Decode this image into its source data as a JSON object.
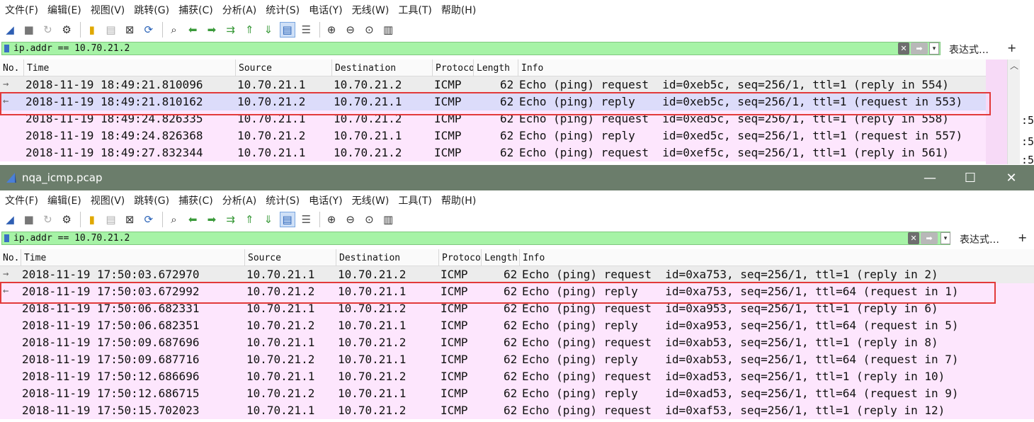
{
  "menu": [
    "文件(F)",
    "编辑(E)",
    "视图(V)",
    "跳转(G)",
    "捕获(C)",
    "分析(A)",
    "统计(S)",
    "电话(Y)",
    "无线(W)",
    "工具(T)",
    "帮助(H)"
  ],
  "toolbar_icons": [
    "shark-fin-icon",
    "stop-icon",
    "restart-icon",
    "options-gear-icon",
    "open-file-icon",
    "save-file-icon",
    "close-file-icon",
    "reload-icon",
    "find-icon",
    "go-back-icon",
    "go-forward-icon",
    "go-to-packet-icon",
    "first-packet-icon",
    "last-packet-icon",
    "autoscroll-icon",
    "colorize-icon",
    "zoom-in-icon",
    "zoom-out-icon",
    "zoom-normal-icon",
    "resize-columns-icon"
  ],
  "filter": {
    "value": "ip.addr == 10.70.21.2",
    "expression_label": "表达式…",
    "plus": "+"
  },
  "columns": {
    "no": "No.",
    "time": "Time",
    "source": "Source",
    "destination": "Destination",
    "protocol": "Protocol",
    "length": "Length",
    "info": "Info"
  },
  "top_pane": {
    "rows": [
      {
        "time": "2018-11-19 18:49:21.810096",
        "src": "10.70.21.1",
        "dst": "10.70.21.2",
        "proto": "ICMP",
        "len": "62",
        "info": "Echo (ping) request  id=0xeb5c, seq=256/1, ttl=1 (reply in 554)"
      },
      {
        "time": "2018-11-19 18:49:21.810162",
        "src": "10.70.21.2",
        "dst": "10.70.21.1",
        "proto": "ICMP",
        "len": "62",
        "info": "Echo (ping) reply    id=0xeb5c, seq=256/1, ttl=1 (request in 553)"
      },
      {
        "time": "2018-11-19 18:49:24.826335",
        "src": "10.70.21.1",
        "dst": "10.70.21.2",
        "proto": "ICMP",
        "len": "62",
        "info": "Echo (ping) request  id=0xed5c, seq=256/1, ttl=1 (reply in 558)"
      },
      {
        "time": "2018-11-19 18:49:24.826368",
        "src": "10.70.21.2",
        "dst": "10.70.21.1",
        "proto": "ICMP",
        "len": "62",
        "info": "Echo (ping) reply    id=0xed5c, seq=256/1, ttl=1 (request in 557)"
      },
      {
        "time": "2018-11-19 18:49:27.832344",
        "src": "10.70.21.1",
        "dst": "10.70.21.2",
        "proto": "ICMP",
        "len": "62",
        "info": "Echo (ping) request  id=0xef5c, seq=256/1, ttl=1 (reply in 561)"
      }
    ],
    "side_fragments": [
      ":5",
      ":5",
      ":5"
    ]
  },
  "window": {
    "title": "nqa_icmp.pcap",
    "minimize": "—",
    "maximize": "☐",
    "close": "✕"
  },
  "bottom_pane": {
    "rows": [
      {
        "time": "2018-11-19 17:50:03.672970",
        "src": "10.70.21.1",
        "dst": "10.70.21.2",
        "proto": "ICMP",
        "len": "62",
        "info": "Echo (ping) request  id=0xa753, seq=256/1, ttl=1 (reply in 2)"
      },
      {
        "time": "2018-11-19 17:50:03.672992",
        "src": "10.70.21.2",
        "dst": "10.70.21.1",
        "proto": "ICMP",
        "len": "62",
        "info": "Echo (ping) reply    id=0xa753, seq=256/1, ttl=64 (request in 1)"
      },
      {
        "time": "2018-11-19 17:50:06.682331",
        "src": "10.70.21.1",
        "dst": "10.70.21.2",
        "proto": "ICMP",
        "len": "62",
        "info": "Echo (ping) request  id=0xa953, seq=256/1, ttl=1 (reply in 6)"
      },
      {
        "time": "2018-11-19 17:50:06.682351",
        "src": "10.70.21.2",
        "dst": "10.70.21.1",
        "proto": "ICMP",
        "len": "62",
        "info": "Echo (ping) reply    id=0xa953, seq=256/1, ttl=64 (request in 5)"
      },
      {
        "time": "2018-11-19 17:50:09.687696",
        "src": "10.70.21.1",
        "dst": "10.70.21.2",
        "proto": "ICMP",
        "len": "62",
        "info": "Echo (ping) request  id=0xab53, seq=256/1, ttl=1 (reply in 8)"
      },
      {
        "time": "2018-11-19 17:50:09.687716",
        "src": "10.70.21.2",
        "dst": "10.70.21.1",
        "proto": "ICMP",
        "len": "62",
        "info": "Echo (ping) reply    id=0xab53, seq=256/1, ttl=64 (request in 7)"
      },
      {
        "time": "2018-11-19 17:50:12.686696",
        "src": "10.70.21.1",
        "dst": "10.70.21.2",
        "proto": "ICMP",
        "len": "62",
        "info": "Echo (ping) request  id=0xad53, seq=256/1, ttl=1 (reply in 10)"
      },
      {
        "time": "2018-11-19 17:50:12.686715",
        "src": "10.70.21.2",
        "dst": "10.70.21.1",
        "proto": "ICMP",
        "len": "62",
        "info": "Echo (ping) reply    id=0xad53, seq=256/1, ttl=64 (request in 9)"
      },
      {
        "time": "2018-11-19 17:50:15.702023",
        "src": "10.70.21.1",
        "dst": "10.70.21.2",
        "proto": "ICMP",
        "len": "62",
        "info": "Echo (ping) request  id=0xaf53, seq=256/1, ttl=1 (reply in 12)"
      }
    ]
  },
  "colors": {
    "icmp_row": "#fde6fd",
    "selected_row": "#dcdcfa",
    "filter_valid": "#a6f3a6",
    "highlight_box": "#e23a3a",
    "titlebar": "#6b7d6b"
  }
}
